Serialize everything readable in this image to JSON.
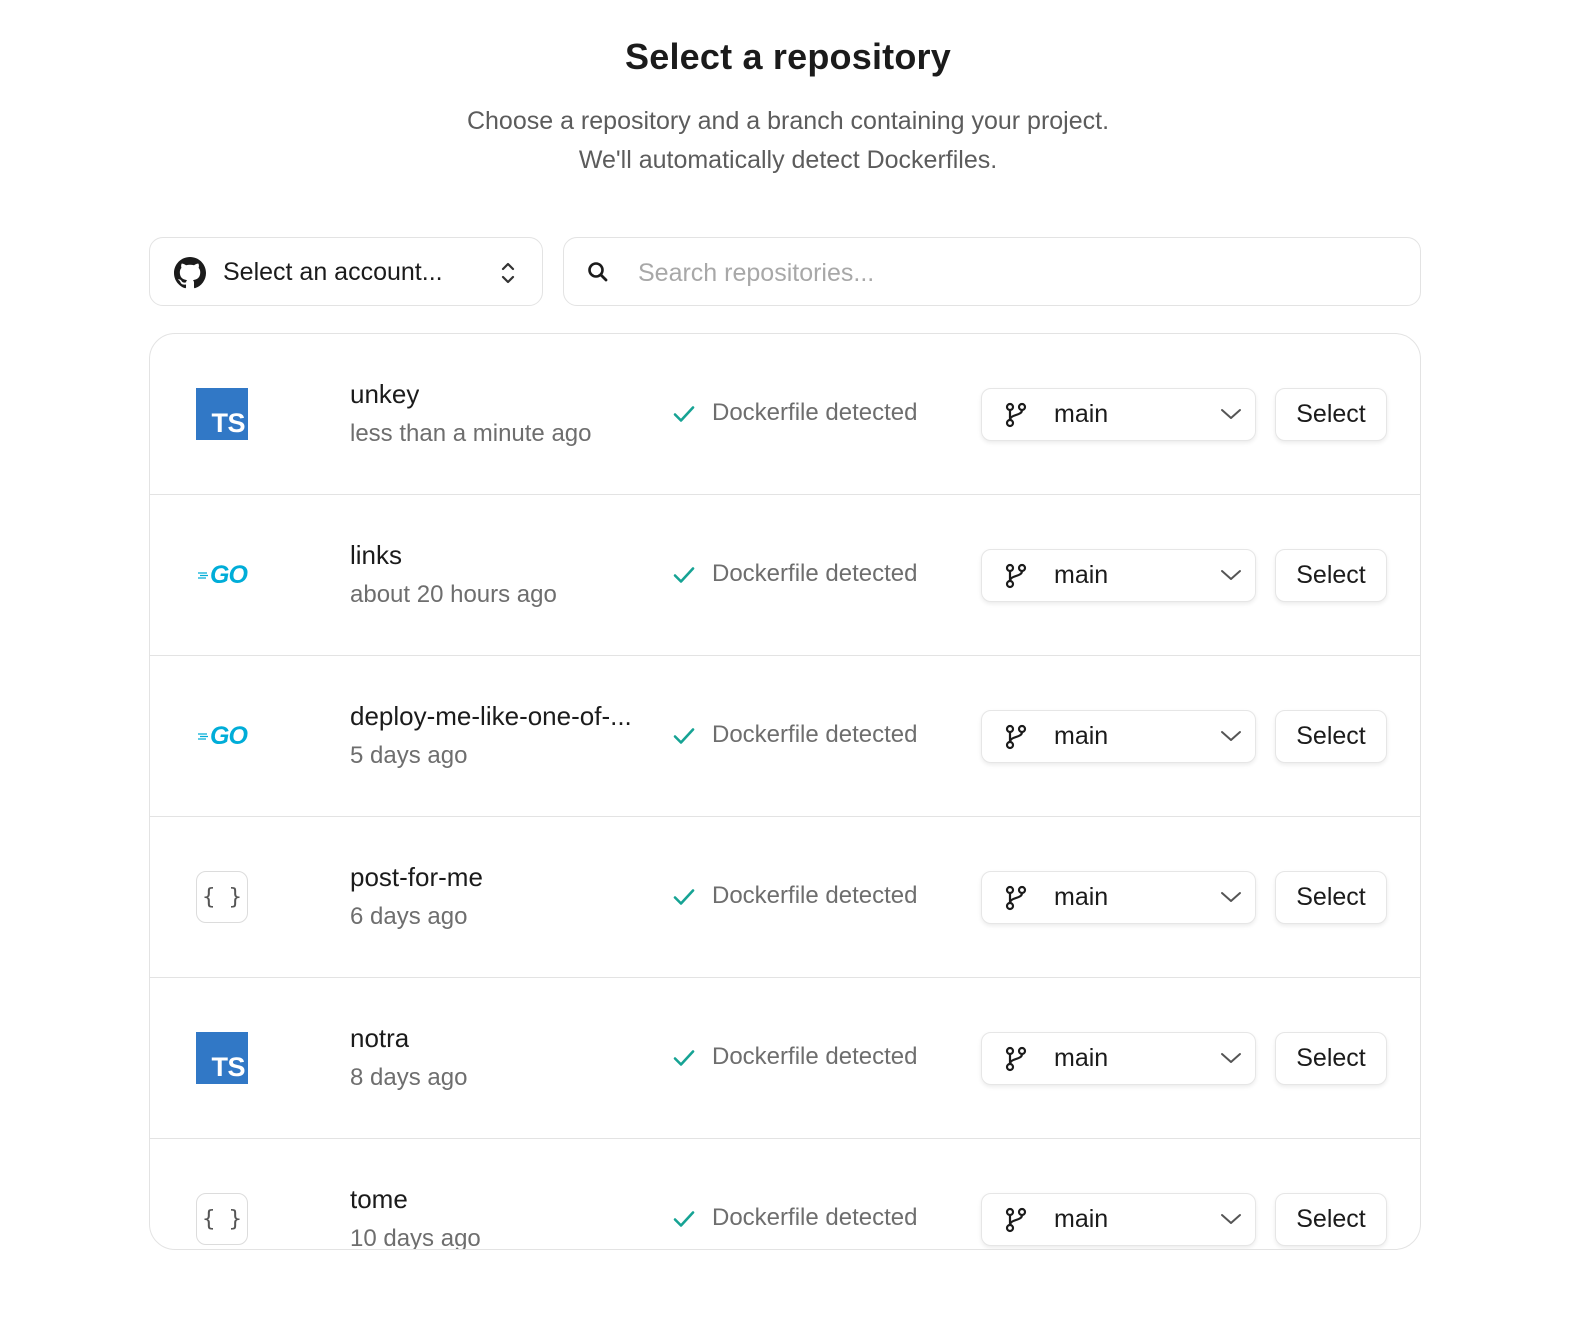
{
  "header": {
    "title": "Select a repository",
    "subtitle_line1": "Choose a repository and a branch containing your project.",
    "subtitle_line2": "We'll automatically detect Dockerfiles."
  },
  "account_select": {
    "label": "Select an account...",
    "icon": "github-icon"
  },
  "search": {
    "placeholder": "Search repositories...",
    "value": ""
  },
  "colors": {
    "accent_check": "#16a394",
    "typescript": "#3178c6",
    "go": "#00add8"
  },
  "repos": [
    {
      "name": "unkey",
      "time": "less than a minute ago",
      "lang": "ts",
      "lang_label": "TS",
      "status": "Dockerfile detected",
      "branch": "main",
      "action": "Select"
    },
    {
      "name": "links",
      "time": "about 20 hours ago",
      "lang": "go",
      "lang_label": "GO",
      "status": "Dockerfile detected",
      "branch": "main",
      "action": "Select"
    },
    {
      "name": "deploy-me-like-one-of-...",
      "time": "5 days ago",
      "lang": "go",
      "lang_label": "GO",
      "status": "Dockerfile detected",
      "branch": "main",
      "action": "Select"
    },
    {
      "name": "post-for-me",
      "time": "6 days ago",
      "lang": "generic",
      "lang_label": "{ }",
      "status": "Dockerfile detected",
      "branch": "main",
      "action": "Select"
    },
    {
      "name": "notra",
      "time": "8 days ago",
      "lang": "ts",
      "lang_label": "TS",
      "status": "Dockerfile detected",
      "branch": "main",
      "action": "Select"
    },
    {
      "name": "tome",
      "time": "10 days ago",
      "lang": "generic",
      "lang_label": "{ }",
      "status": "Dockerfile detected",
      "branch": "main",
      "action": "Select"
    }
  ]
}
